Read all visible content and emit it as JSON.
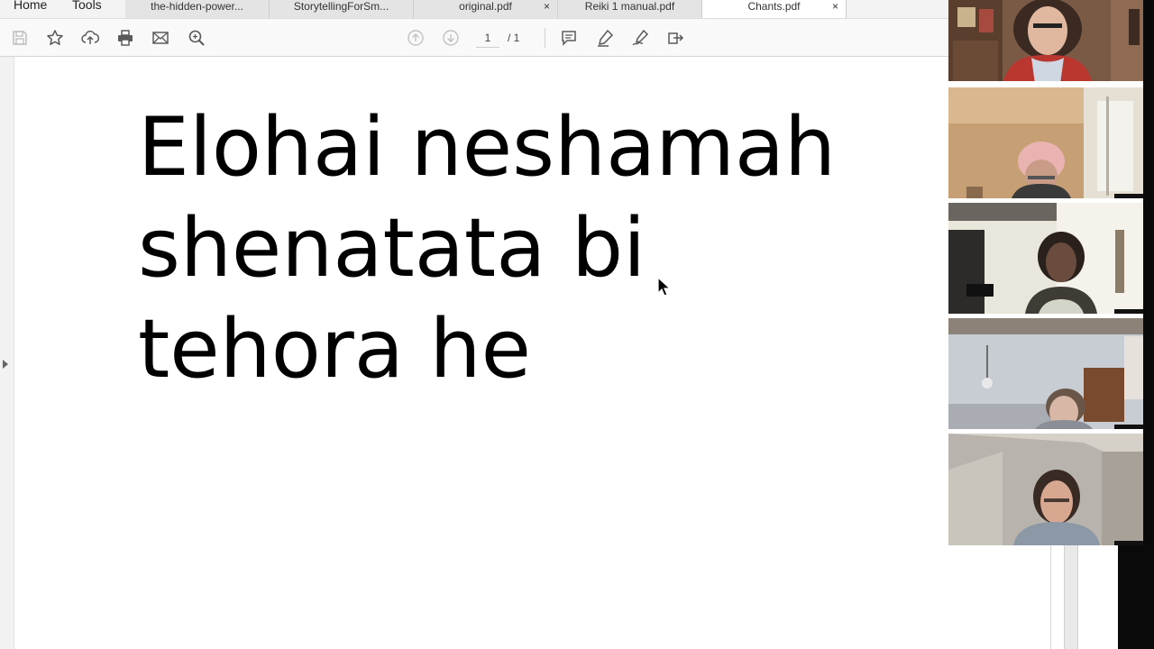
{
  "tabbar": {
    "home_label": "Home",
    "tools_label": "Tools",
    "tabs": [
      {
        "label": "the-hidden-power..."
      },
      {
        "label": "StorytellingForSm..."
      },
      {
        "label": "original.pdf",
        "close": "×"
      },
      {
        "label": "Reiki 1 manual.pdf"
      },
      {
        "label": "Chants.pdf",
        "close": "×"
      }
    ]
  },
  "toolbar": {
    "icons": [
      "save-icon",
      "star-icon",
      "upload-icon",
      "print-icon",
      "mail-icon",
      "zoom-icon",
      "page-up-icon",
      "page-down-icon",
      "comment-icon",
      "highlight-icon",
      "sign-icon",
      "share-icon"
    ],
    "page_current": "1",
    "page_total": "/ 1"
  },
  "document": {
    "lines": [
      "Elohai neshamah",
      "shenatata bi",
      "tehora he"
    ]
  },
  "video": {
    "participants": [
      "participant-1",
      "participant-2",
      "participant-3",
      "participant-4",
      "participant-5"
    ]
  },
  "colors": {
    "chrome": "#f3f3f3",
    "toolbar": "#f9f9f9",
    "icon": "#5a5a5a"
  }
}
